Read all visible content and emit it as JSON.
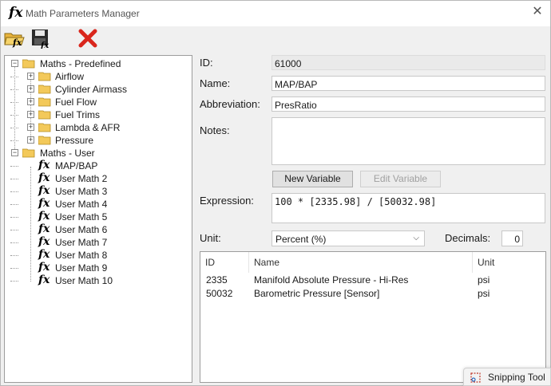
{
  "window": {
    "title": "Math Parameters Manager"
  },
  "toolbar": {
    "open_icon": "open-folder-fx-icon",
    "save_icon": "save-disk-icon",
    "delete_icon": "red-x-delete-icon"
  },
  "tree": {
    "predefined": {
      "label": "Maths - Predefined",
      "children": [
        "Airflow",
        "Cylinder Airmass",
        "Fuel Flow",
        "Fuel Trims",
        "Lambda & AFR",
        "Pressure"
      ]
    },
    "user": {
      "label": "Maths - User",
      "children": [
        "MAP/BAP",
        "User Math 2",
        "User Math 3",
        "User Math 4",
        "User Math 5",
        "User Math 6",
        "User Math 7",
        "User Math 8",
        "User Math 9",
        "User Math 10"
      ]
    }
  },
  "form": {
    "id_label": "ID:",
    "id_value": "61000",
    "name_label": "Name:",
    "name_value": "MAP/BAP",
    "abbr_label": "Abbreviation:",
    "abbr_value": "PresRatio",
    "notes_label": "Notes:",
    "notes_value": "",
    "new_variable": "New Variable",
    "edit_variable": "Edit Variable",
    "expression_label": "Expression:",
    "expression_value": "100 * [2335.98] / [50032.98]",
    "unit_label": "Unit:",
    "unit_value": "Percent (%)",
    "decimals_label": "Decimals:",
    "decimals_value": "0"
  },
  "grid": {
    "headers": [
      "ID",
      "Name",
      "Unit"
    ],
    "rows": [
      [
        "2335",
        "Manifold Absolute Pressure - Hi-Res",
        "psi"
      ],
      [
        "50032",
        "Barometric Pressure [Sensor]",
        "psi"
      ]
    ]
  },
  "overlay": {
    "snipping_tool": "Snipping Tool"
  },
  "colors": {
    "folder": "#f3c95a",
    "delete": "#d9261c",
    "window_bg": "#f0f0f0"
  }
}
